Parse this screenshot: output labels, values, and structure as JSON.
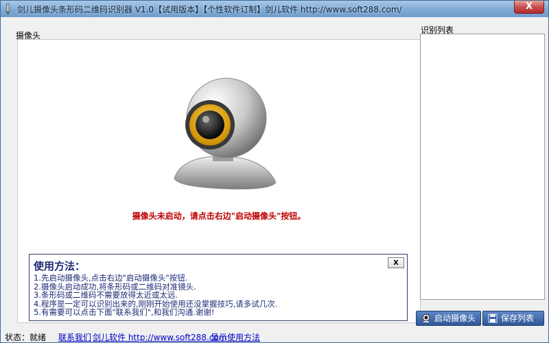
{
  "window": {
    "title": "剑儿摄像头条形码二维码识别器 V1.0【试用版本】【个性软件订制】剑儿软件 http://www.soft288.com/",
    "close_label": "X",
    "icon": "app-icon"
  },
  "camera_panel": {
    "label": "摄像头",
    "status_message": "摄像头未启动，请点击右边\"启动摄像头\"按钮。",
    "image": "webcam-image"
  },
  "help": {
    "title": "使用方法：",
    "close_label": "X",
    "lines": [
      "1.先启动摄像头,点击右边\"启动摄像头\"按钮.",
      "2.摄像头启动成功,将条形码或二维码对准镜头.",
      "3.条形码或二维码不需要放得太近或太远.",
      "4.程序是一定可以识别出来的,刚刚开始使用还没掌握技巧,请多试几次.",
      "5.有需要可以点击下面\"联系我们\",和我们沟通.谢谢!"
    ]
  },
  "recognition_list": {
    "label": "识别列表",
    "items": []
  },
  "buttons": {
    "start_camera": "启动摄像头",
    "save_list": "保存列表"
  },
  "statusbar": {
    "status": "状态：就绪",
    "contact": "联系我们",
    "website": "剑儿软件 http://www.soft288.com",
    "show_help": "显示使用方法"
  },
  "colors": {
    "status_red": "#c00000",
    "help_text": "#1c2a75",
    "link": "#0000cc"
  }
}
